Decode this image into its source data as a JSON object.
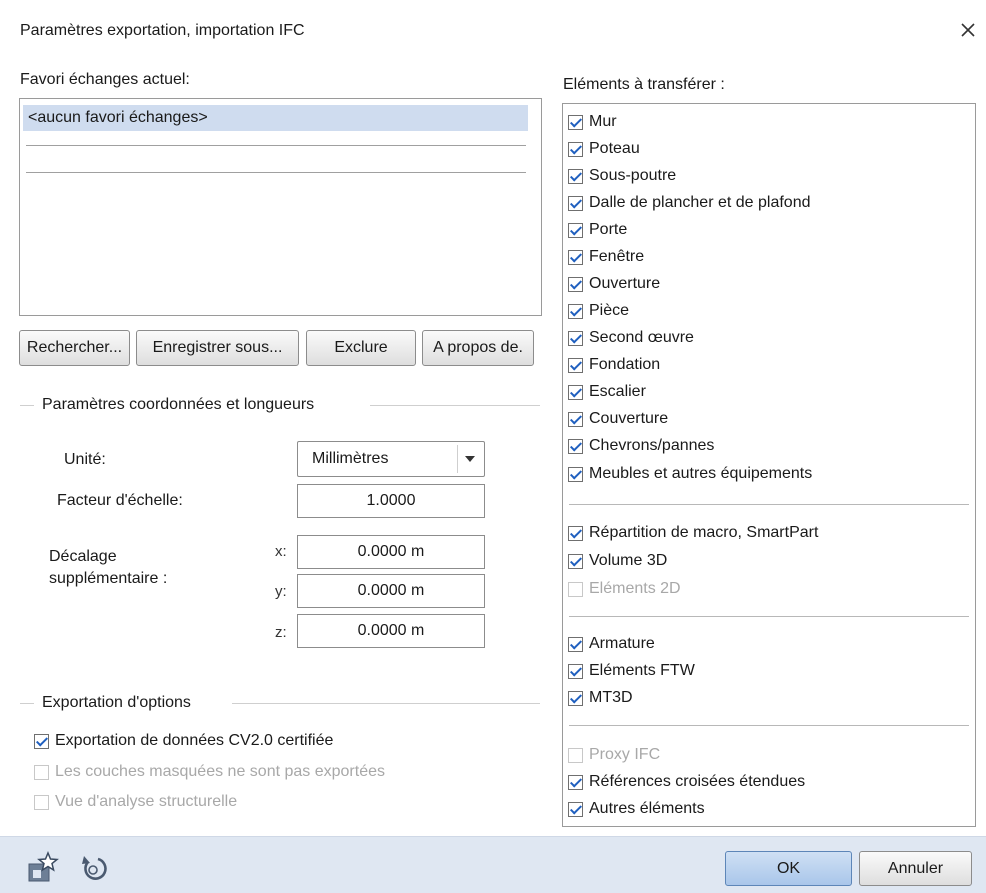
{
  "window": {
    "title": "Paramètres exportation, importation IFC"
  },
  "favorites": {
    "label": "Favori échanges actuel:",
    "items": [
      "<aucun favori échanges>",
      "",
      ""
    ]
  },
  "buttons": {
    "search": "Rechercher...",
    "save_as": "Enregistrer sous...",
    "exclude": "Exclure",
    "about": "A propos de."
  },
  "coordinates": {
    "group_title": "Paramètres coordonnées et longueurs",
    "unit_label": "Unité:",
    "unit_value": "Millimètres",
    "scale_label": "Facteur d'échelle:",
    "scale_value": "1.0000",
    "offset_label_1": "Décalage",
    "offset_label_2": "supplémentaire :",
    "x_label": "x:",
    "x_value": "0.0000 m",
    "y_label": "y:",
    "y_value": "0.0000 m",
    "z_label": "z:",
    "z_value": "0.0000 m"
  },
  "export_options": {
    "group_title": "Exportation d'options",
    "options": [
      {
        "label": "Exportation de données CV2.0 certifiée",
        "checked": true,
        "enabled": true
      },
      {
        "label": "Les couches masquées ne sont pas exportées",
        "checked": false,
        "enabled": false
      },
      {
        "label": "Vue d'analyse structurelle",
        "checked": false,
        "enabled": false
      }
    ]
  },
  "elements": {
    "label": "Eléments à transférer :",
    "items": [
      {
        "label": "Mur",
        "checked": true,
        "enabled": true
      },
      {
        "label": "Poteau",
        "checked": true,
        "enabled": true
      },
      {
        "label": "Sous-poutre",
        "checked": true,
        "enabled": true
      },
      {
        "label": "Dalle de plancher et de plafond",
        "checked": true,
        "enabled": true
      },
      {
        "label": "Porte",
        "checked": true,
        "enabled": true
      },
      {
        "label": "Fenêtre",
        "checked": true,
        "enabled": true
      },
      {
        "label": "Ouverture",
        "checked": true,
        "enabled": true
      },
      {
        "label": "Pièce",
        "checked": true,
        "enabled": true
      },
      {
        "label": "Second œuvre",
        "checked": true,
        "enabled": true
      },
      {
        "label": "Fondation",
        "checked": true,
        "enabled": true
      },
      {
        "label": "Escalier",
        "checked": true,
        "enabled": true
      },
      {
        "label": "Couverture",
        "checked": true,
        "enabled": true
      },
      {
        "label": "Chevrons/pannes",
        "checked": true,
        "enabled": true
      },
      {
        "label": "Meubles et autres équipements",
        "checked": true,
        "enabled": true
      },
      {
        "label": "Répartition de macro, SmartPart",
        "checked": true,
        "enabled": true
      },
      {
        "label": "Volume 3D",
        "checked": true,
        "enabled": true
      },
      {
        "label": "Eléments 2D",
        "checked": false,
        "enabled": false
      },
      {
        "label": "Armature",
        "checked": true,
        "enabled": true
      },
      {
        "label": "Eléments FTW",
        "checked": true,
        "enabled": true
      },
      {
        "label": "MT3D",
        "checked": true,
        "enabled": true
      },
      {
        "label": "Proxy IFC",
        "checked": false,
        "enabled": false
      },
      {
        "label": "Références croisées étendues",
        "checked": true,
        "enabled": true
      },
      {
        "label": "Autres éléments",
        "checked": true,
        "enabled": true
      }
    ]
  },
  "footer": {
    "ok": "OK",
    "cancel": "Annuler"
  },
  "icons": {
    "close": "close-icon",
    "favorite": "favorite-star-icon",
    "reset": "reset-icon",
    "dropdown": "chevron-down-icon"
  },
  "colors": {
    "accent": "#1f5fbf",
    "selection": "#cfdcef",
    "footer": "#dfe7f2"
  }
}
